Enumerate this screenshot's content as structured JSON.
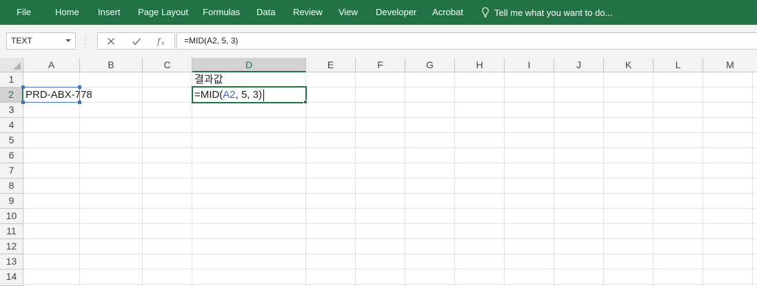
{
  "ribbon": {
    "tabs": [
      "File",
      "Home",
      "Insert",
      "Page Layout",
      "Formulas",
      "Data",
      "Review",
      "View",
      "Developer",
      "Acrobat"
    ],
    "tell_me": "Tell me what you want to do..."
  },
  "formula_bar": {
    "name_box": "TEXT",
    "formula": "=MID(A2, 5, 3)"
  },
  "sheet": {
    "columns": [
      "A",
      "B",
      "C",
      "D",
      "E",
      "F",
      "G",
      "H",
      "I",
      "J",
      "K",
      "L",
      "M"
    ],
    "rows": [
      "1",
      "2",
      "3",
      "4",
      "5",
      "6",
      "7",
      "8",
      "9",
      "10",
      "11",
      "12",
      "13",
      "14"
    ],
    "active_column": "D",
    "active_row": "2",
    "cells": {
      "D1": "결과값",
      "A2": "PRD-ABX-778"
    },
    "editing": {
      "prefix": "=MID(",
      "ref": "A2",
      "suffix": ", 5, 3)"
    }
  },
  "colors": {
    "accent": "#217346",
    "reference": "#4472c4"
  }
}
